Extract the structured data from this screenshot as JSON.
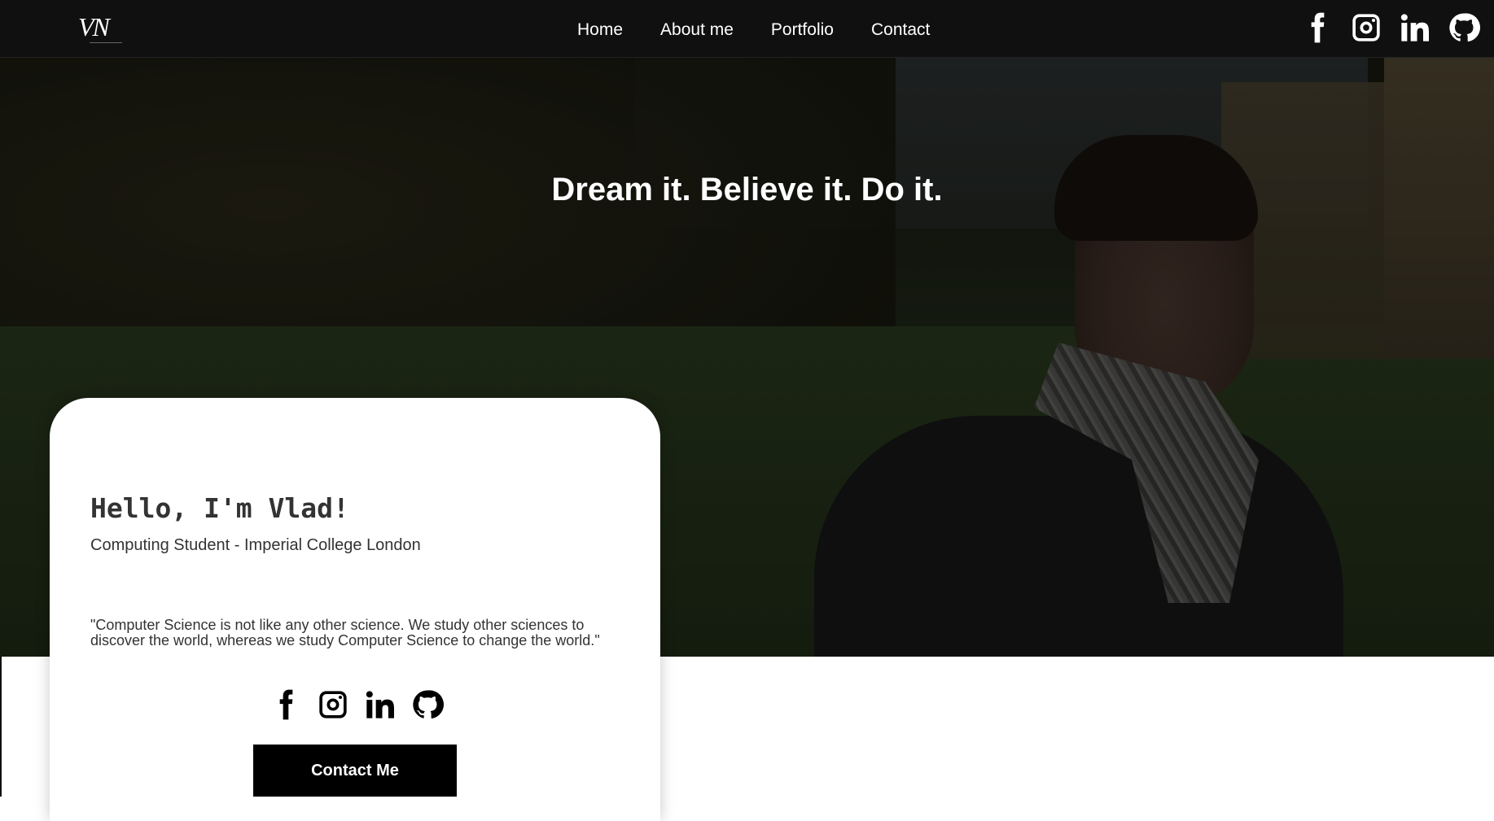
{
  "brand": {
    "logo_text": "VN"
  },
  "nav": {
    "items": [
      {
        "label": "Home"
      },
      {
        "label": "About me"
      },
      {
        "label": "Portfolio"
      },
      {
        "label": "Contact"
      }
    ],
    "social_icons": [
      "facebook-icon",
      "instagram-icon",
      "linkedin-icon",
      "github-icon"
    ]
  },
  "hero": {
    "tagline": "Dream it. Believe it. Do it."
  },
  "card": {
    "heading": "Hello, I'm Vlad!",
    "role": "Computing Student - Imperial College London",
    "quote": "\"Computer Science is not like any other science. We study other sciences to discover the world, whereas we study Computer Science to change the world.\"",
    "social_icons": [
      "facebook-icon",
      "instagram-icon",
      "linkedin-icon",
      "github-icon"
    ],
    "contact_button": "Contact Me"
  },
  "colors": {
    "nav_bg": "#101010",
    "button_bg": "#000000",
    "text": "#333333"
  }
}
